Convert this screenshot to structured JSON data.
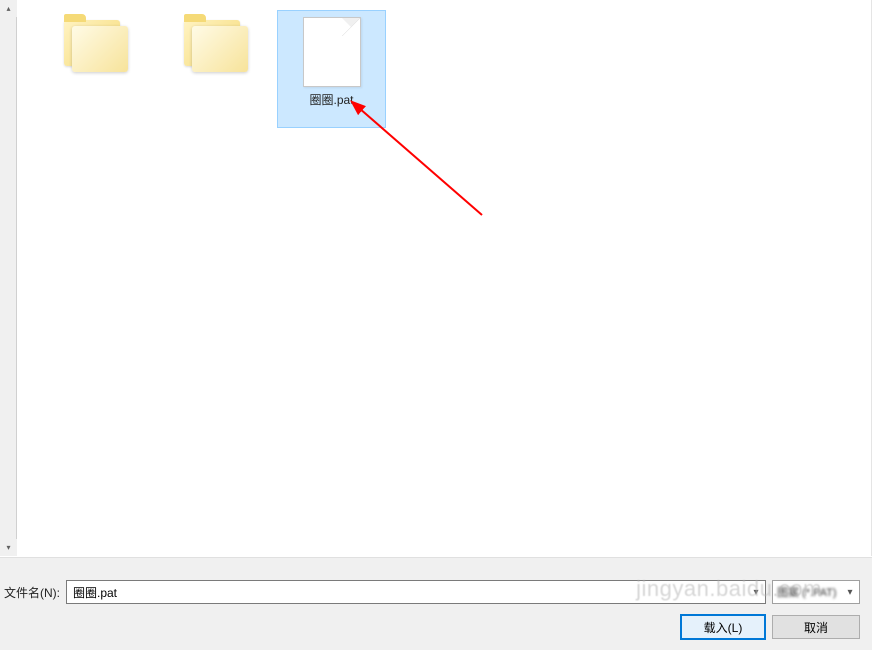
{
  "files": {
    "folder1_label": "　　",
    "folder2_label": "　　　　",
    "pat_file_label": "圈圈.pat"
  },
  "footer": {
    "filename_prefix": "文件名(N):",
    "filename_value": "圈圈.pat",
    "filter_label": "图案 (*.PAT)",
    "load_label": "载入(L)",
    "cancel_label": "取消"
  },
  "watermark": "jingyan.baidu.com"
}
